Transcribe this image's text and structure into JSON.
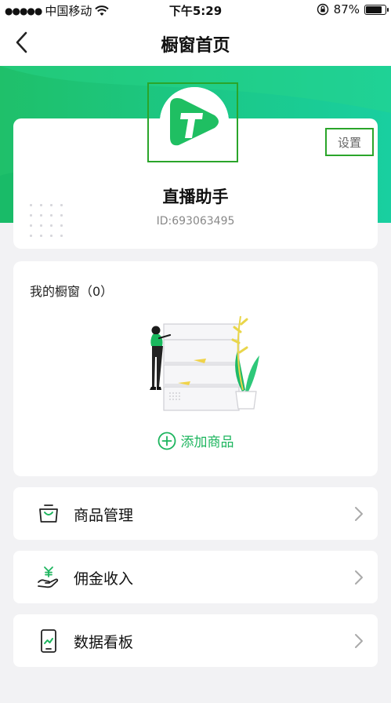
{
  "status_bar": {
    "carrier": "中国移动",
    "time": "下午5:29",
    "battery_text": "87%",
    "battery_level": 0.87
  },
  "nav": {
    "title": "橱窗首页"
  },
  "profile": {
    "name": "直播助手",
    "id_text": "ID:693063495",
    "settings_label": "设置"
  },
  "showcase": {
    "title": "我的橱窗（0）",
    "add_label": "添加商品"
  },
  "menu": [
    {
      "label": "商品管理",
      "icon": "shopping-bag-icon"
    },
    {
      "label": "佣金收入",
      "icon": "hand-yuan-icon"
    },
    {
      "label": "数据看板",
      "icon": "phone-chart-icon"
    }
  ],
  "colors": {
    "brand_green": "#1db55e",
    "highlight_border": "#2aa52a"
  }
}
